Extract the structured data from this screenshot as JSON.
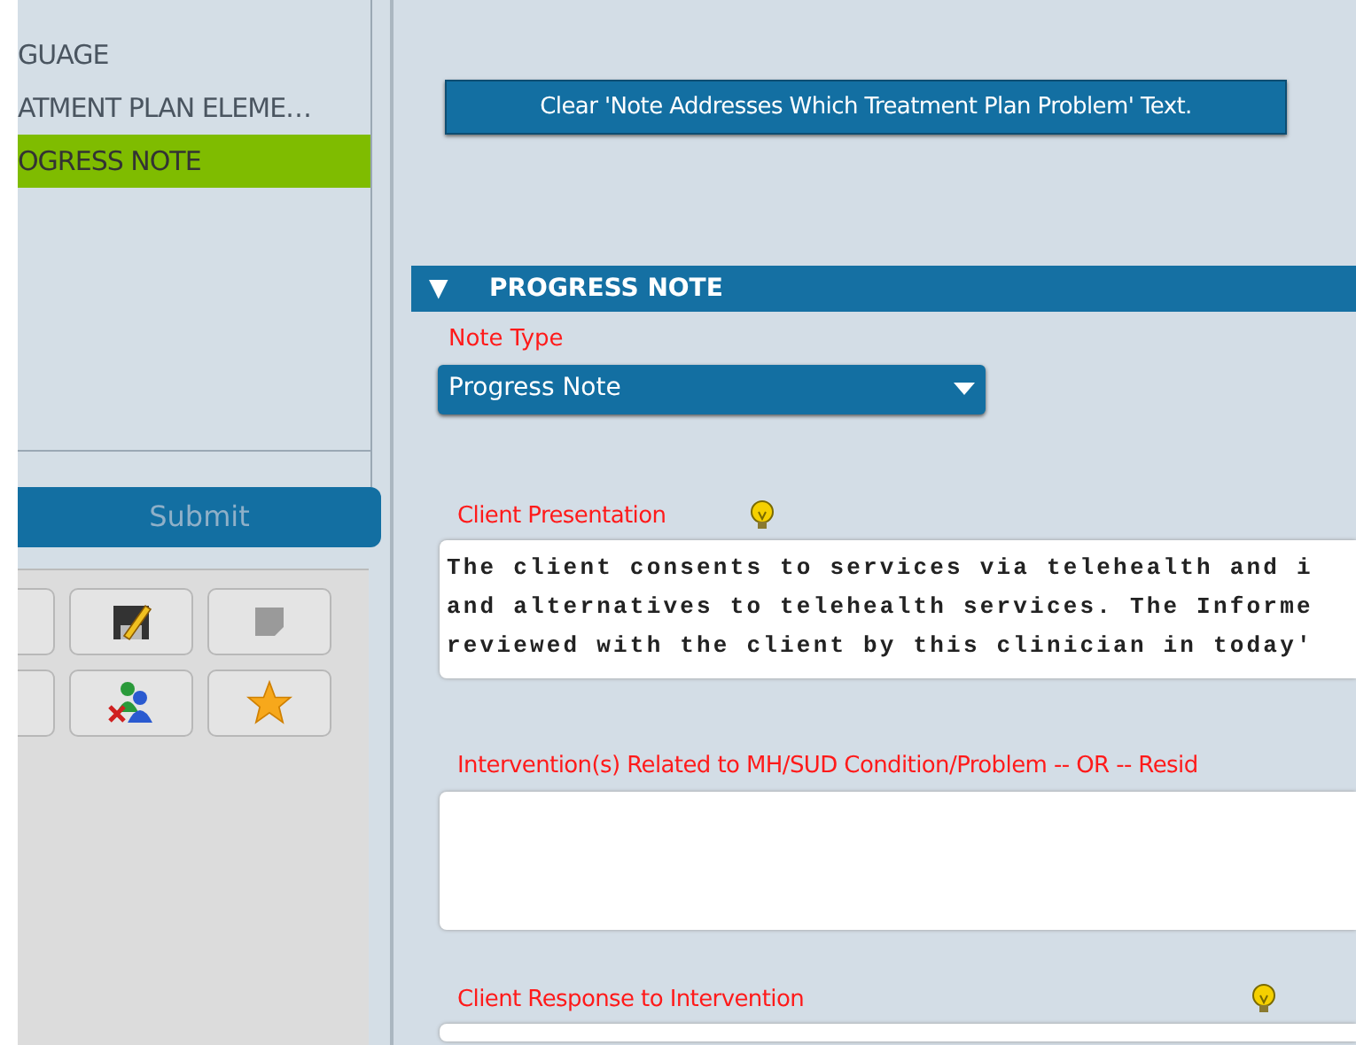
{
  "sidebar": {
    "items": [
      {
        "label": "GUAGE",
        "selected": false
      },
      {
        "label": "ATMENT PLAN ELEME…",
        "selected": false
      },
      {
        "label": "OGRESS NOTE",
        "selected": true
      }
    ]
  },
  "submit_button": {
    "label": "Submit",
    "disabled": true
  },
  "toolbar": [
    [
      {
        "kind": "blank"
      },
      {
        "kind": "save-edit"
      },
      {
        "kind": "note"
      }
    ],
    [
      {
        "kind": "blank"
      },
      {
        "kind": "users-remove"
      },
      {
        "kind": "star"
      }
    ]
  ],
  "clear_button": {
    "label": "Clear 'Note Addresses Which Treatment Plan Problem' Text."
  },
  "section": {
    "title": "PROGRESS NOTE",
    "expanded": true,
    "toggle": "▼",
    "fields": [
      {
        "kind": "dropdown",
        "label": "Note Type",
        "value": "Progress Note"
      },
      {
        "kind": "textarea",
        "label": "Client Presentation",
        "hint": true,
        "lines": [
          "The client consents to services via telehealth and i",
          "and alternatives to telehealth services. The Informe",
          "reviewed with the client by this clinician in today'"
        ]
      },
      {
        "kind": "textarea",
        "label": "Intervention(s) Related to MH/SUD Condition/Problem -- OR -- Resid",
        "hint": false
      },
      {
        "kind": "textarea",
        "label": "Client Response to Intervention",
        "hint": true,
        "hint_right": true
      }
    ]
  }
}
